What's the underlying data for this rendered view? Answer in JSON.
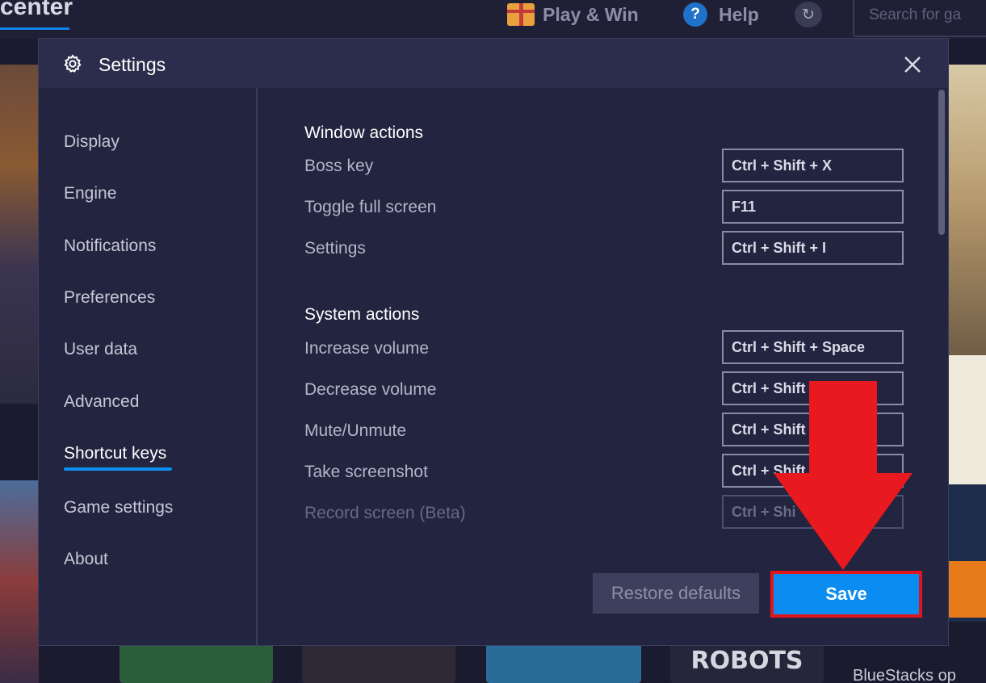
{
  "background": {
    "brand_text": "center",
    "nav": {
      "play_win": "Play & Win",
      "help": "Help",
      "help_glyph": "?",
      "refresh_glyph": "↻"
    },
    "search_placeholder": "Search for ga",
    "tile_robots": "ROBOTS",
    "footer_text": "BlueStacks op"
  },
  "dialog": {
    "title": "Settings",
    "close_glyph": "✕"
  },
  "sidebar": {
    "items": [
      {
        "label": "Display"
      },
      {
        "label": "Engine"
      },
      {
        "label": "Notifications"
      },
      {
        "label": "Preferences"
      },
      {
        "label": "User data"
      },
      {
        "label": "Advanced"
      },
      {
        "label": "Shortcut keys",
        "active": true
      },
      {
        "label": "Game settings"
      },
      {
        "label": "About"
      }
    ]
  },
  "shortcuts": {
    "window_actions": {
      "title": "Window actions",
      "rows": [
        {
          "label": "Boss key",
          "key": "Ctrl + Shift + X"
        },
        {
          "label": "Toggle full screen",
          "key": "F11"
        },
        {
          "label": "Settings",
          "key": "Ctrl + Shift + I"
        }
      ]
    },
    "system_actions": {
      "title": "System actions",
      "rows": [
        {
          "label": "Increase volume",
          "key": "Ctrl + Shift + Space"
        },
        {
          "label": "Decrease volume",
          "key": "Ctrl + Shift"
        },
        {
          "label": "Mute/Unmute",
          "key": "Ctrl + Shift"
        },
        {
          "label": "Take screenshot",
          "key": "Ctrl + Shift"
        },
        {
          "label": "Record screen (Beta)",
          "key": "Ctrl + Shi"
        }
      ]
    }
  },
  "footer": {
    "restore_label": "Restore defaults",
    "save_label": "Save"
  },
  "colors": {
    "accent_blue": "#0a8cf0",
    "annotation_red": "#e0161c",
    "dialog_bg": "#23243f"
  }
}
